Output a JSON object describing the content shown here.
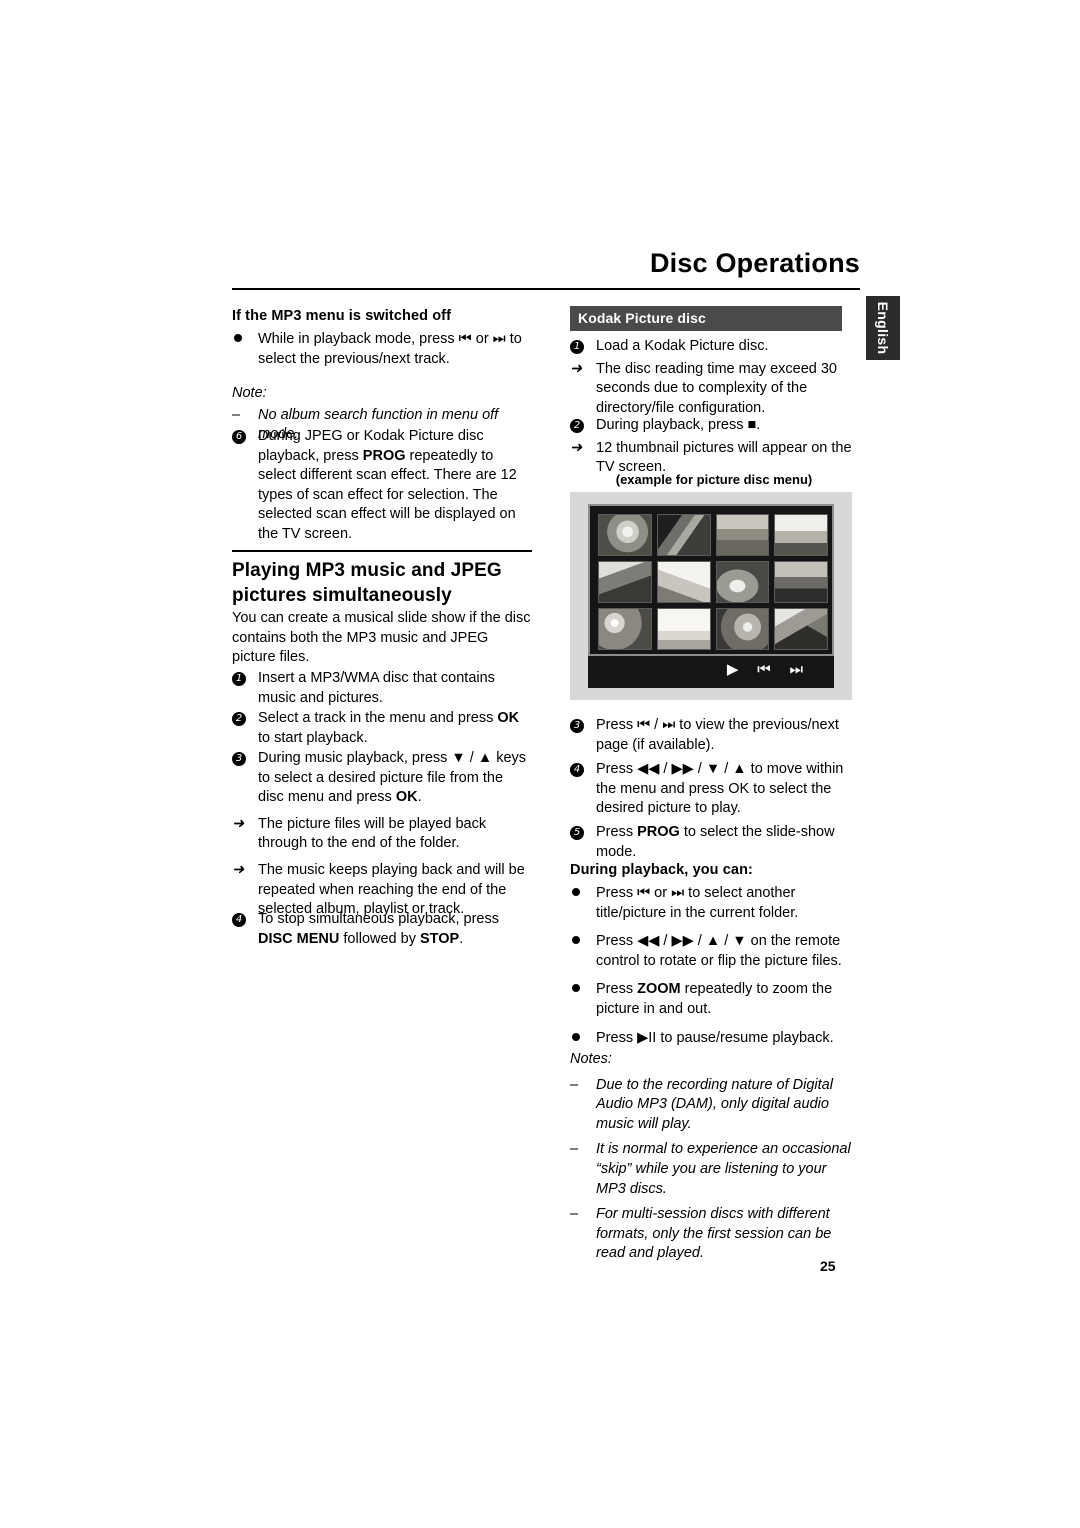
{
  "header": {
    "title": "Disc Operations",
    "side_tab": "English"
  },
  "page_number": "25",
  "left_column": {
    "subhead_mp3_off": "If the MP3 menu is switched off",
    "bullet1": "While in playback mode, press ⏮ or ⏭ to select the previous/next track.",
    "note_label": "Note:",
    "note_text": "No album search function in menu off mode.",
    "item6": "During JPEG or Kodak Picture disc playback, press PROG repeatedly to select different scan effect. There are 12 types of scan effect for selection. The selected scan effect will be displayed on the TV screen.",
    "item6_parts": {
      "a": "During JPEG or Kodak Picture disc playback,",
      "b": "press ",
      "prog": "PROG",
      "c": " repeatedly to select different scan effect. There are 12 types of scan effect for selection. The selected scan effect will be displayed on the TV screen."
    },
    "section_title": "Playing MP3 music and JPEG pictures simultaneously",
    "intro": "You can create a musical slide show if the disc contains both the MP3 music and JPEG picture files.",
    "step1": "Insert a MP3/WMA disc that contains music and pictures.",
    "step2_a": "Select a track in the menu and press ",
    "step2_ok": "OK",
    "step2_b": " to start playback.",
    "step3_a": "During music playback, press ▼ / ▲ keys to select a desired picture file from the disc menu and press ",
    "step3_ok": "OK",
    "step3_b": ".",
    "step3_arrow1": "The picture files will be played back through to the end of the folder.",
    "step3_arrow2": "The music keeps playing back and will be repeated when reaching the end of the selected album, playlist or track.",
    "step4_a": "To stop simultaneous playback, press ",
    "step4_disc": "DISC MENU",
    "step4_b": " followed by ",
    "step4_stop": "STOP",
    "step4_c": "."
  },
  "right_column": {
    "kodak_heading": "Kodak Picture disc",
    "step1": "Load a Kodak Picture disc.",
    "step1_arrow": "The disc reading time may exceed 30 seconds due to complexity of the directory/file configuration.",
    "step2": "During playback, press ■.",
    "step2_arrow": "12 thumbnail pictures will appear on the TV screen.",
    "example_caption": "(example for picture disc menu)",
    "tv_controls": "▶  ⏮  ⏭",
    "step3": "Press ⏮ / ⏭ to view the previous/next page (if available).",
    "step4": "Press ◀◀ / ▶▶ / ▼ / ▲ to move within the menu and press OK to select the desired picture to play.",
    "step5_a": "Press ",
    "step5_prog": "PROG",
    "step5_b": " to select the slide-show mode.",
    "during_playback_head": "During playback, you can:",
    "b1": "Press ⏮ or ⏭ to select another title/picture in the current folder.",
    "b2": "Press ◀◀ / ▶▶ / ▲ / ▼ on the remote control to rotate or flip the picture files.",
    "b3_a": "Press ",
    "b3_zoom": "ZOOM",
    "b3_b": " repeatedly to zoom the picture in and out.",
    "b4": "Press ▶II to pause/resume playback.",
    "notes_label": "Notes:",
    "note1": "Due to the recording nature of Digital Audio MP3 (DAM), only digital audio music will play.",
    "note2": "It is normal to experience an occasional “skip” while you are listening to your MP3 discs.",
    "note3": "For multi-session discs with different formats, only the first session can be read and played."
  },
  "colors": {
    "kodak_bar_bg": "#4a4a4a",
    "side_tab_bg": "#2b2b2b",
    "tv_frame_bg": "#d8d8d8",
    "tv_screen_bg": "#151515"
  }
}
